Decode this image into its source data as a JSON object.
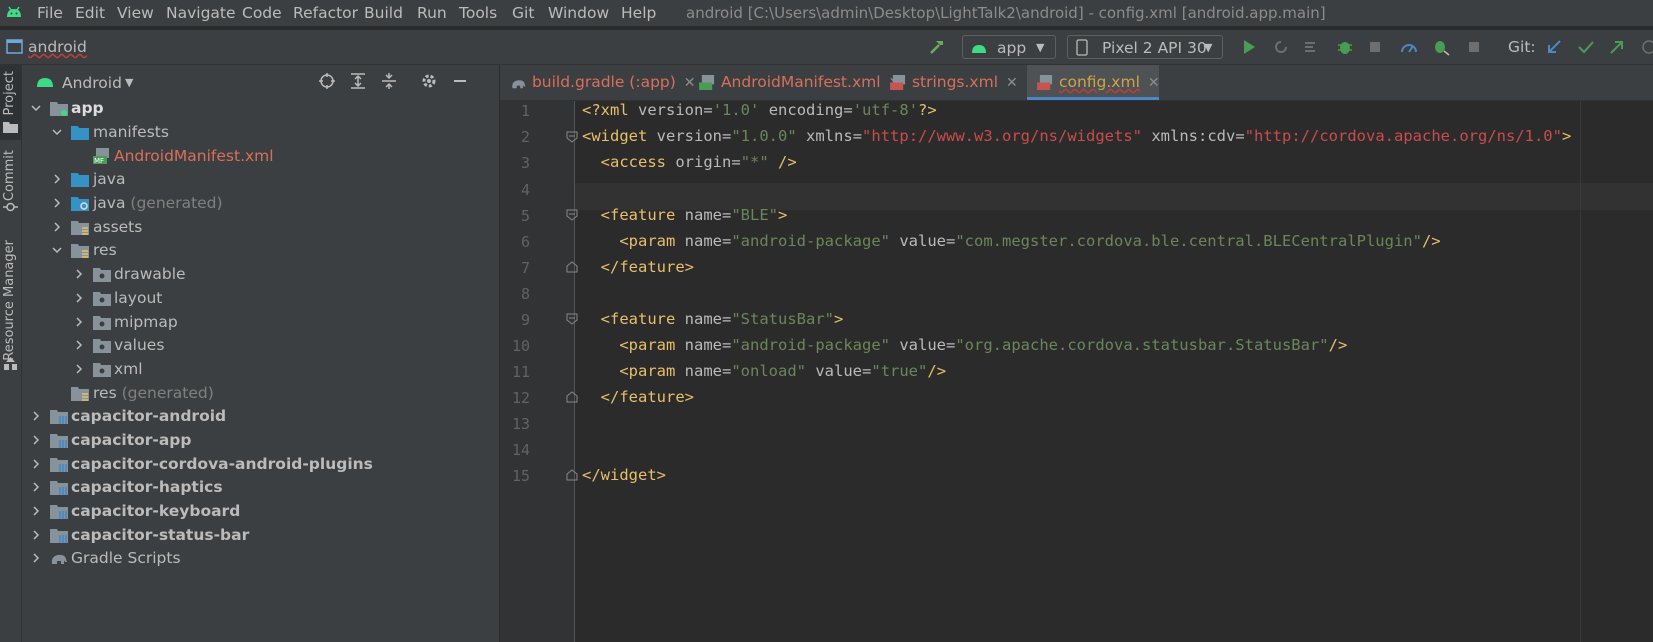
{
  "menubar": {
    "items": [
      "File",
      "Edit",
      "View",
      "Navigate",
      "Code",
      "Refactor",
      "Build",
      "Run",
      "Tools",
      "Git",
      "Window",
      "Help"
    ],
    "window_title": "android [C:\\Users\\admin\\Desktop\\LightTalk2\\android] - config.xml [android.app.main]"
  },
  "toolbar": {
    "breadcrumb": "android",
    "run_config": "app",
    "device": "Pixel 2 API 30",
    "git_label": "Git:"
  },
  "left_strip": {
    "tabs": [
      "Project",
      "Commit",
      "Resource Manager"
    ]
  },
  "project_panel": {
    "title": "Android",
    "tree": [
      {
        "label": "app",
        "suffix": ""
      },
      {
        "label": "manifests",
        "suffix": ""
      },
      {
        "label": "AndroidManifest.xml",
        "suffix": ""
      },
      {
        "label": "java",
        "suffix": ""
      },
      {
        "label": "java",
        "suffix": " (generated)"
      },
      {
        "label": "assets",
        "suffix": ""
      },
      {
        "label": "res",
        "suffix": ""
      },
      {
        "label": "drawable",
        "suffix": ""
      },
      {
        "label": "layout",
        "suffix": ""
      },
      {
        "label": "mipmap",
        "suffix": ""
      },
      {
        "label": "values",
        "suffix": ""
      },
      {
        "label": "xml",
        "suffix": ""
      },
      {
        "label": "res",
        "suffix": " (generated)"
      },
      {
        "label": "capacitor-android",
        "suffix": ""
      },
      {
        "label": "capacitor-app",
        "suffix": ""
      },
      {
        "label": "capacitor-cordova-android-plugins",
        "suffix": ""
      },
      {
        "label": "capacitor-haptics",
        "suffix": ""
      },
      {
        "label": "capacitor-keyboard",
        "suffix": ""
      },
      {
        "label": "capacitor-status-bar",
        "suffix": ""
      },
      {
        "label": "Gradle Scripts",
        "suffix": ""
      }
    ]
  },
  "tabs": [
    {
      "label": "build.gradle (:app)"
    },
    {
      "label": "AndroidManifest.xml"
    },
    {
      "label": "strings.xml"
    },
    {
      "label": "config.xml"
    }
  ],
  "editor": {
    "line_numbers": [
      "1",
      "2",
      "3",
      "4",
      "5",
      "6",
      "7",
      "8",
      "9",
      "10",
      "11",
      "12",
      "13",
      "14",
      "15"
    ],
    "lines": [
      "<?xml version='1.0' encoding='utf-8'?>",
      "<widget version=\"1.0.0\" xmlns=\"http://www.w3.org/ns/widgets\" xmlns:cdv=\"http://cordova.apache.org/ns/1.0\">",
      "  <access origin=\"*\" />",
      "",
      "  <feature name=\"BLE\">",
      "    <param name=\"android-package\" value=\"com.megster.cordova.ble.central.BLECentralPlugin\"/>",
      "  </feature>",
      "",
      "  <feature name=\"StatusBar\">",
      "    <param name=\"android-package\" value=\"org.apache.cordova.statusbar.StatusBar\"/>",
      "    <param name=\"onload\" value=\"true\"/>",
      "  </feature>",
      "",
      "",
      "</widget>"
    ]
  },
  "colors": {
    "background": "#2b2b2b",
    "panel": "#3c3f41",
    "tag": "#e8bf6a",
    "string": "#6a8759",
    "url": "#cc4b4b",
    "accent_green": "#499c54",
    "accent_blue": "#4a88c7"
  }
}
